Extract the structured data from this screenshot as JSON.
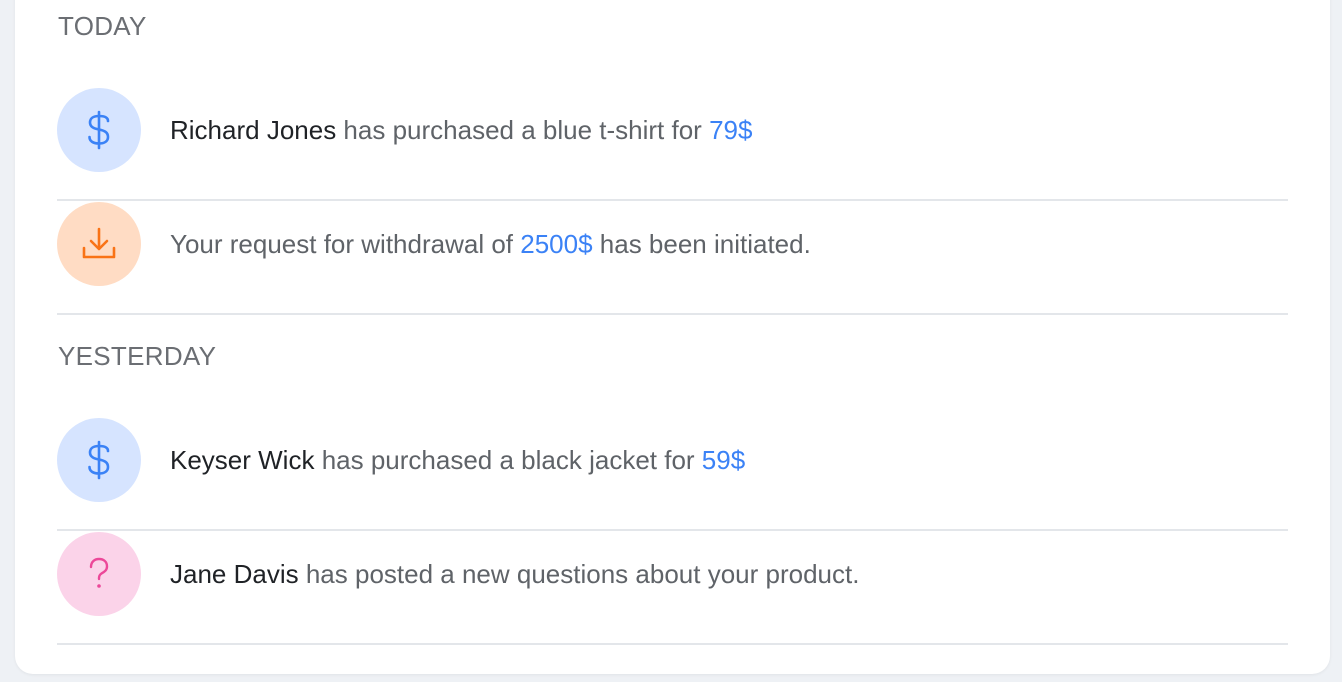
{
  "sections": [
    {
      "title": "TODAY",
      "items": [
        {
          "icon": "dollar-icon",
          "name": "Richard Jones",
          "text_before": " has purchased a blue t-shirt for ",
          "amount": "79$",
          "text_after": ""
        },
        {
          "icon": "download-icon",
          "name": "",
          "text_before": "Your request for withdrawal of ",
          "amount": "2500$",
          "text_after": " has been initiated."
        }
      ]
    },
    {
      "title": "YESTERDAY",
      "items": [
        {
          "icon": "dollar-icon",
          "name": "Keyser Wick",
          "text_before": " has purchased a black jacket for ",
          "amount": "59$",
          "text_after": ""
        },
        {
          "icon": "question-icon",
          "name": "Jane Davis",
          "text_before": " has posted a new questions about your product.",
          "amount": "",
          "text_after": ""
        }
      ]
    }
  ],
  "colors": {
    "blue_bg": "#d6e4ff",
    "blue_icon": "#3b82f6",
    "orange_bg": "#ffdcc4",
    "orange_icon": "#f97316",
    "pink_bg": "#fbd3e9",
    "pink_icon": "#ec4899",
    "amount": "#3b82f6"
  }
}
